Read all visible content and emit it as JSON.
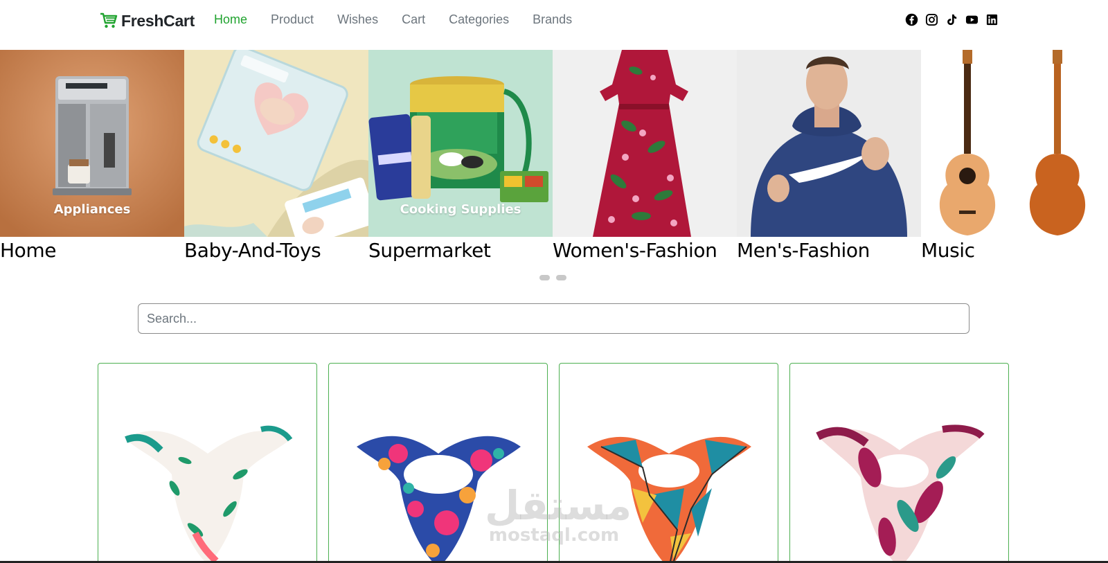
{
  "navbar": {
    "brand": "FreshCart",
    "links": [
      {
        "label": "Home",
        "active": true
      },
      {
        "label": "Product",
        "active": false
      },
      {
        "label": "Wishes",
        "active": false
      },
      {
        "label": "Cart",
        "active": false
      },
      {
        "label": "Categories",
        "active": false
      },
      {
        "label": "Brands",
        "active": false
      }
    ],
    "socials": [
      "facebook-icon",
      "instagram-icon",
      "tiktok-icon",
      "youtube-icon",
      "linkedin-icon"
    ]
  },
  "slider": {
    "slides": [
      {
        "overlay": "Appliances",
        "label": "Home"
      },
      {
        "overlay": "",
        "label": "Baby-And-Toys"
      },
      {
        "overlay": "Cooking Supplies",
        "label": "Supermarket"
      },
      {
        "overlay": "",
        "label": "Women's-Fashion"
      },
      {
        "overlay": "",
        "label": "Men's-Fashion"
      },
      {
        "overlay": "",
        "label": "Music"
      }
    ],
    "dots": 2
  },
  "search": {
    "placeholder": "Search...",
    "value": ""
  },
  "products": [
    {
      "image": "scarf-white-floral"
    },
    {
      "image": "scarf-blue-pink-floral"
    },
    {
      "image": "scarf-teal-orange-geometric"
    },
    {
      "image": "scarf-pink-maroon-leaf"
    }
  ],
  "watermark": {
    "arabic": "مستقل",
    "latin": "mostaql.com"
  },
  "colors": {
    "accent": "#20a32f",
    "card_border": "#4caf50"
  }
}
